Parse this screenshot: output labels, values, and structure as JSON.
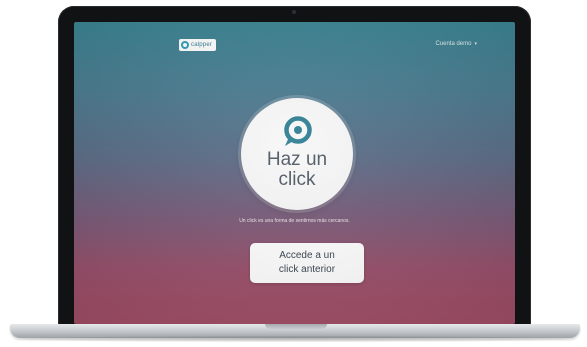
{
  "app": {
    "brand_name": "calpper"
  },
  "header": {
    "account_link": "Cuenta demo"
  },
  "hero": {
    "line1": "Haz un",
    "line2": "click",
    "hint": "Un click es una forma de sentirnos más cercanos."
  },
  "cta": {
    "line1": "Accede a un",
    "line2": "click anterior"
  },
  "colors": {
    "accent": "#2f7f93",
    "gradient_top": "#3a8493",
    "gradient_bottom": "#a24e66"
  },
  "icons": {
    "brand": "chat-bubble-logo-icon",
    "hero": "chat-bubble-icon",
    "dropdown": "chevron-down-icon"
  }
}
